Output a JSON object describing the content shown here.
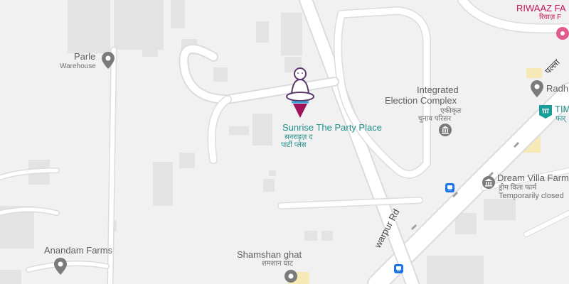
{
  "colors": {
    "background": "#f1f1f1",
    "road": "#ffffff",
    "road_edge": "#dadce0",
    "building": "#e3e3e3",
    "poi_gray": "#5f6368",
    "poi_teal": "#1f8f8a",
    "poi_pink": "#c2185b",
    "selected_marker": "#a0125a",
    "transit": "#1a73e8"
  },
  "places": {
    "riwaaz": {
      "name": "RIWAAZ FA",
      "name_local": "रिवाज़ F",
      "icon": "restaurant-pin-icon"
    },
    "parle": {
      "name": "Parle",
      "subtitle": "Warehouse",
      "icon": "location-pin-icon"
    },
    "integrated": {
      "name_line1": "Integrated",
      "name_line2": "Election Complex",
      "local_line1": "एकीकृत",
      "local_line2": "चुनाव परिसर",
      "icon": "government-building-icon"
    },
    "sunrise": {
      "name": "Sunrise The Party Place",
      "local_line1": "सनराइज़ द",
      "local_line2": "पार्टी प्लेस",
      "icon": "selected-place-marker"
    },
    "radh": {
      "name": "Radh",
      "icon": "location-pin-icon"
    },
    "tim": {
      "name": "TIM",
      "local": "फार्",
      "icon": "museum-icon"
    },
    "dream_villa": {
      "name": "Dream Villa Farm",
      "local": "ड्रीम विला फार्म",
      "status": "Temporarily closed",
      "icon": "government-building-icon"
    },
    "anandam": {
      "name": "Anandam Farms",
      "icon": "location-pin-icon"
    },
    "shamshan": {
      "name": "Shamshan ghat",
      "local": "शमशान घाट",
      "icon": "location-pin-icon"
    }
  },
  "roads": {
    "main_road": "warpur Rd",
    "main_road_local": "पल्ला"
  },
  "transit": {
    "stops": [
      "bus-stop-icon",
      "bus-stop-icon"
    ]
  }
}
